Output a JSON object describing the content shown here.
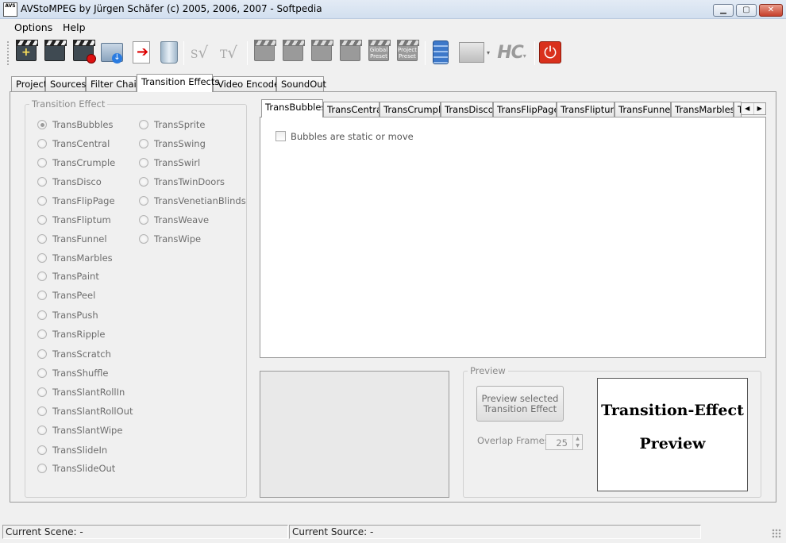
{
  "window": {
    "title": "AVStoMPEG by Jürgen Schäfer (c) 2005, 2006, 2007 - Softpedia",
    "icon_text": "AVS",
    "controls": [
      "minimize-icon",
      "maximize-icon",
      "close-icon"
    ]
  },
  "menu": {
    "items": [
      "Options",
      "Help"
    ]
  },
  "toolbar": {
    "sign_s": "S",
    "sign_t": "T",
    "global_preset": "Global Preset",
    "project_preset": "Project Preset",
    "hc_label": "HC",
    "icons": [
      "new-project-icon",
      "open-project-icon",
      "remove-project-icon",
      "save-project-icon",
      "export-arrow-icon",
      "recycle-bin-icon",
      "sign-s-check-icon",
      "sign-t-check-icon",
      "clapboard-icon",
      "clapboard-icon",
      "clapboard-icon",
      "clapboard-icon",
      "global-preset-icon",
      "project-preset-icon",
      "calculator-icon",
      "settings-icon",
      "hc-icon",
      "power-icon"
    ]
  },
  "main_tabs": [
    "Project",
    "Sources",
    "Filter Chain",
    "Transition Effects",
    "Video Encoder",
    "SoundOut"
  ],
  "active_main_tab": "Transition Effects",
  "transition_group": {
    "legend": "Transition Effect",
    "col1": [
      "TransBubbles",
      "TransCentral",
      "TransCrumple",
      "TransDisco",
      "TransFlipPage",
      "TransFliptum",
      "TransFunnel",
      "TransMarbles",
      "TransPaint",
      "TransPeel",
      "TransPush",
      "TransRipple",
      "TransScratch",
      "TransShuffle",
      "TransSlantRollIn",
      "TransSlantRollOut",
      "TransSlantWipe",
      "TransSlideIn",
      "TransSlideOut"
    ],
    "col2": [
      "TransSprite",
      "TransSwing",
      "TransSwirl",
      "TransTwinDoors",
      "TransVenetianBlinds",
      "TransWeave",
      "TransWipe"
    ],
    "selected": "TransBubbles"
  },
  "effect_tabs": [
    "TransBubbles",
    "TransCentral",
    "TransCrumple",
    "TransDisco",
    "TransFlipPage",
    "TransFliptum",
    "TransFunnel",
    "TransMarbles",
    "T"
  ],
  "effect_options": {
    "checkbox_label": "Bubbles are static or move",
    "checked": false
  },
  "preview": {
    "legend": "Preview",
    "button_label": "Preview selected Transition Effect",
    "overlap_label": "Overlap Frames:",
    "overlap_value": "25",
    "image_line1": "Transition-Effect",
    "image_line2": "Preview"
  },
  "statusbar": {
    "scene": "Current Scene: -",
    "source": "Current Source: -"
  }
}
